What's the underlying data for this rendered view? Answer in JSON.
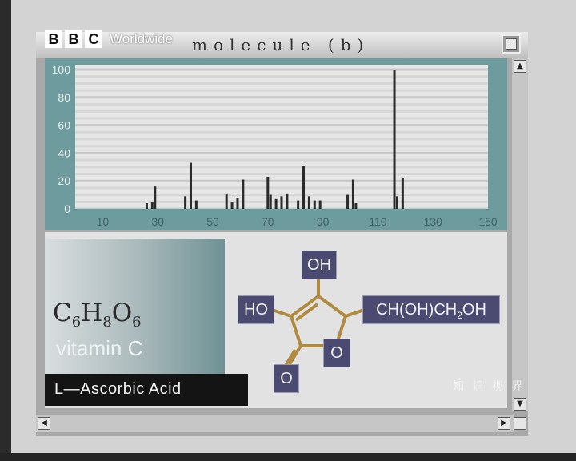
{
  "branding": {
    "bbc_letters": [
      "B",
      "B",
      "C"
    ],
    "worldwide": "Worldwide"
  },
  "window": {
    "title": "molecule (b)"
  },
  "chart_data": {
    "type": "bar",
    "title": "",
    "xlabel": "",
    "ylabel": "",
    "xlim": [
      0,
      150
    ],
    "ylim": [
      0,
      100
    ],
    "x_ticks": [
      "10",
      "30",
      "50",
      "70",
      "90",
      "110",
      "130",
      "150"
    ],
    "y_ticks": [
      "100",
      "80",
      "60",
      "40",
      "20",
      "0"
    ],
    "grid": true,
    "bars": [
      {
        "x": 26,
        "y": 4
      },
      {
        "x": 28,
        "y": 5
      },
      {
        "x": 29,
        "y": 16
      },
      {
        "x": 40,
        "y": 9
      },
      {
        "x": 42,
        "y": 33
      },
      {
        "x": 44,
        "y": 6
      },
      {
        "x": 55,
        "y": 11
      },
      {
        "x": 57,
        "y": 5
      },
      {
        "x": 59,
        "y": 8
      },
      {
        "x": 61,
        "y": 21
      },
      {
        "x": 70,
        "y": 23
      },
      {
        "x": 71,
        "y": 10
      },
      {
        "x": 73,
        "y": 7
      },
      {
        "x": 75,
        "y": 9
      },
      {
        "x": 77,
        "y": 11
      },
      {
        "x": 81,
        "y": 6
      },
      {
        "x": 83,
        "y": 31
      },
      {
        "x": 85,
        "y": 9
      },
      {
        "x": 87,
        "y": 6
      },
      {
        "x": 89,
        "y": 6
      },
      {
        "x": 99,
        "y": 10
      },
      {
        "x": 101,
        "y": 21
      },
      {
        "x": 102,
        "y": 4
      },
      {
        "x": 116,
        "y": 100
      },
      {
        "x": 117,
        "y": 9
      },
      {
        "x": 119,
        "y": 22
      }
    ]
  },
  "molecule": {
    "formula": {
      "C": "C",
      "c_sub": "6",
      "H": "H",
      "h_sub": "8",
      "O": "O",
      "o_sub": "6"
    },
    "name": "vitamin C",
    "chemical_name": "L—Ascorbic  Acid",
    "groups": {
      "oh_top": "OH",
      "ho_left": "HO",
      "side_chain_a": "CH(OH)CH",
      "side_chain_sub": "2",
      "side_chain_b": "OH",
      "ring_o": "O",
      "carbonyl_o": "O"
    }
  },
  "watermark": "知 识 视 界",
  "colors": {
    "plot_bg": "#e6e6e6",
    "axis_bg": "#6e9b9e",
    "bar": "#2a2a2a",
    "node_bg": "#4b4a70",
    "bond": "#b08a3e"
  }
}
